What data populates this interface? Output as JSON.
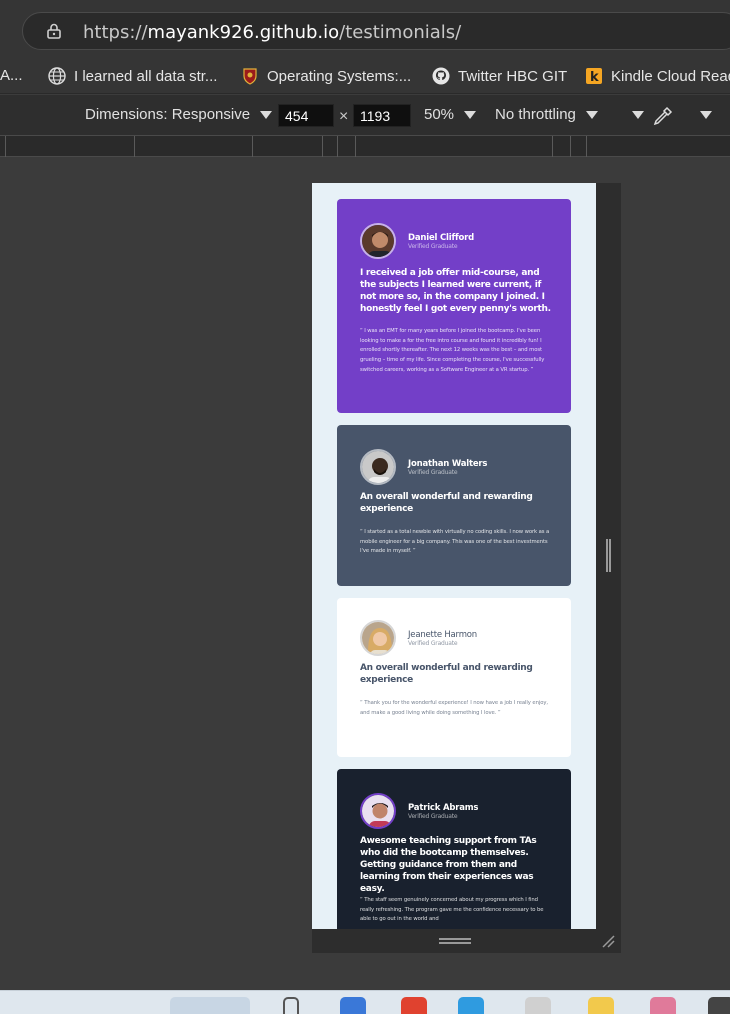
{
  "browser": {
    "url_scheme": "https://",
    "url_host": "mayank926.github.io",
    "url_path": "/testimonials/"
  },
  "bookmarks": [
    {
      "label": "A...",
      "icon": "truncated-bookmark"
    },
    {
      "label": "I learned all data str...",
      "icon": "globe-icon"
    },
    {
      "label": "Operating Systems:...",
      "icon": "crest-icon"
    },
    {
      "label": "Twitter HBC GIT",
      "icon": "github-icon"
    },
    {
      "label": "Kindle Cloud Read",
      "icon": "kindle-icon"
    }
  ],
  "devtools": {
    "dimensions_label": "Dimensions: Responsive",
    "width": "454",
    "height": "1193",
    "zoom": "50%",
    "throttling": "No throttling"
  },
  "testimonials": [
    {
      "name": "Daniel Clifford",
      "role": "Verified Graduate",
      "headline": "I received a job offer mid-course, and the subjects I learned were current, if not more so, in the company I joined. I honestly feel I got every penny's worth.",
      "quote": "“ I was an EMT for many years before I joined the bootcamp. I've been looking to make a for the free intro course and found it incredibly fun! I enrolled shortly thereafter. The next 12 weeks was the best – and most grueling – time of my life. Since completing the course, I've successfully switched careers, working as a Software Engineer at a VR startup. ”"
    },
    {
      "name": "Jonathan Walters",
      "role": "Verified Graduate",
      "headline": "An overall wonderful and rewarding experience",
      "quote": "“ I started as a total newbie with virtually no coding skills. I now work as a mobile engineer for a big company. This was one of the best investments I've made in myself. ”"
    },
    {
      "name": "Jeanette Harmon",
      "role": "Verified Graduate",
      "headline": "An overall wonderful and rewarding experience",
      "quote": "“ Thank you for the wonderful experience! I now have a job I really enjoy, and make a good living while doing something I love. ”"
    },
    {
      "name": "Patrick Abrams",
      "role": "Verified Graduate",
      "headline": "Awesome teaching support from TAs who did the bootcamp themselves. Getting guidance from them and learning from their experiences was easy.",
      "quote": "“ The staff seem genuinely concerned about my progress which I find really refreshing. The program gave me the confidence necessary to be able to go out in the world and"
    }
  ],
  "colors": {
    "violet": "#733fc8",
    "grayish_blue": "#48556a",
    "white": "#ffffff",
    "blackish_blue": "#19212e",
    "page_bg": "#e7f1f7"
  }
}
